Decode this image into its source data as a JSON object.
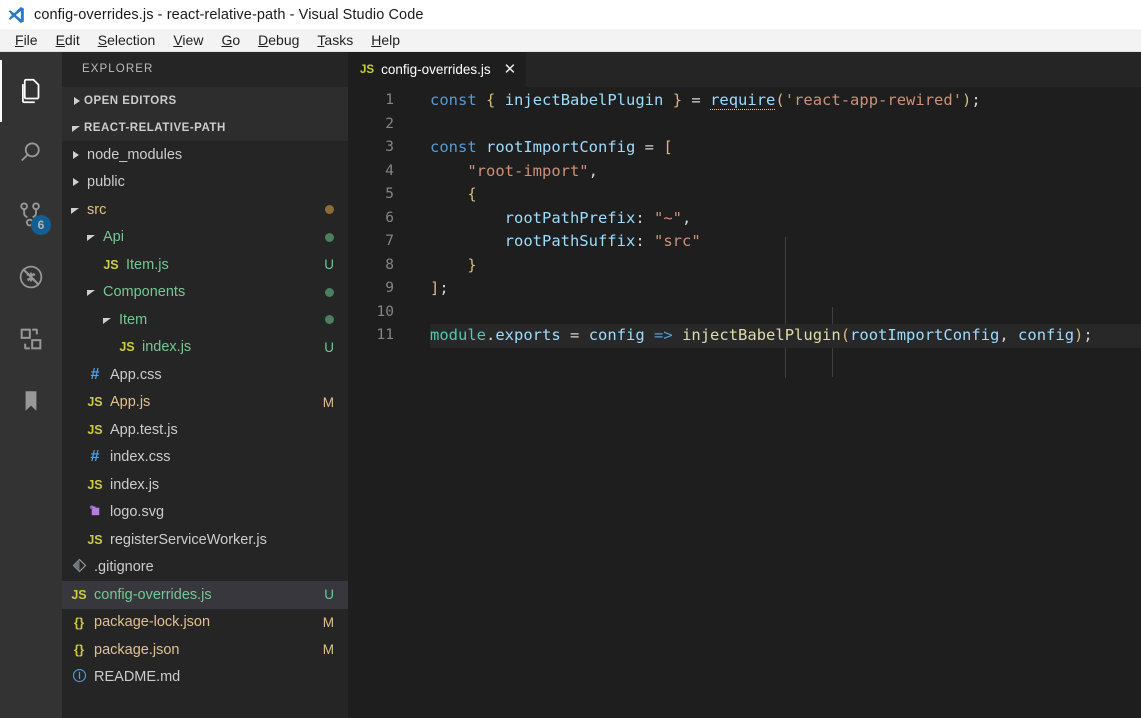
{
  "window": {
    "title": "config-overrides.js - react-relative-path - Visual Studio Code",
    "logo_icon": "vscode-logo-icon"
  },
  "menubar": {
    "items": [
      {
        "label": "File",
        "accel": "F"
      },
      {
        "label": "Edit",
        "accel": "E"
      },
      {
        "label": "Selection",
        "accel": "S"
      },
      {
        "label": "View",
        "accel": "V"
      },
      {
        "label": "Go",
        "accel": "G"
      },
      {
        "label": "Debug",
        "accel": "D"
      },
      {
        "label": "Tasks",
        "accel": "T"
      },
      {
        "label": "Help",
        "accel": "H"
      }
    ]
  },
  "activitybar": {
    "items": [
      {
        "name": "explorer",
        "icon": "files-icon",
        "active": true,
        "badge": ""
      },
      {
        "name": "search",
        "icon": "search-icon",
        "active": false,
        "badge": ""
      },
      {
        "name": "source-control",
        "icon": "source-control-icon",
        "active": false,
        "badge": "6"
      },
      {
        "name": "debug",
        "icon": "debug-icon",
        "active": false,
        "badge": ""
      },
      {
        "name": "extensions",
        "icon": "extensions-icon",
        "active": false,
        "badge": ""
      },
      {
        "name": "bookmarks",
        "icon": "bookmark-icon",
        "active": false,
        "badge": ""
      }
    ],
    "badge_color": "#007acc"
  },
  "sidebar": {
    "title": "EXPLORER",
    "sections": [
      {
        "label": "OPEN EDITORS",
        "expanded": false
      },
      {
        "label": "REACT-RELATIVE-PATH",
        "expanded": true
      }
    ],
    "tree": [
      {
        "label": "node_modules",
        "type": "folder",
        "expanded": false,
        "indent": 1,
        "deco": "",
        "deco_kind": "",
        "color": "default"
      },
      {
        "label": "public",
        "type": "folder",
        "expanded": false,
        "indent": 1,
        "deco": "",
        "deco_kind": "",
        "color": "default"
      },
      {
        "label": "src",
        "type": "folder",
        "expanded": true,
        "indent": 1,
        "deco": "dot",
        "deco_kind": "folder-mod",
        "color": "mod"
      },
      {
        "label": "Api",
        "type": "folder",
        "expanded": true,
        "indent": 2,
        "deco": "dot",
        "deco_kind": "green",
        "color": "green"
      },
      {
        "label": "Item.js",
        "type": "js",
        "expanded": null,
        "indent": 3,
        "deco": "U",
        "deco_kind": "green",
        "color": "green"
      },
      {
        "label": "Components",
        "type": "folder",
        "expanded": true,
        "indent": 2,
        "deco": "dot",
        "deco_kind": "green",
        "color": "green"
      },
      {
        "label": "Item",
        "type": "folder",
        "expanded": true,
        "indent": 3,
        "deco": "dot",
        "deco_kind": "green",
        "color": "green"
      },
      {
        "label": "index.js",
        "type": "js",
        "expanded": null,
        "indent": 4,
        "deco": "U",
        "deco_kind": "green",
        "color": "green"
      },
      {
        "label": "App.css",
        "type": "css",
        "expanded": null,
        "indent": 2,
        "deco": "",
        "deco_kind": "",
        "color": "default"
      },
      {
        "label": "App.js",
        "type": "js",
        "expanded": null,
        "indent": 2,
        "deco": "M",
        "deco_kind": "mod",
        "color": "mod"
      },
      {
        "label": "App.test.js",
        "type": "js",
        "expanded": null,
        "indent": 2,
        "deco": "",
        "deco_kind": "",
        "color": "default"
      },
      {
        "label": "index.css",
        "type": "css",
        "expanded": null,
        "indent": 2,
        "deco": "",
        "deco_kind": "",
        "color": "default"
      },
      {
        "label": "index.js",
        "type": "js",
        "expanded": null,
        "indent": 2,
        "deco": "",
        "deco_kind": "",
        "color": "default"
      },
      {
        "label": "logo.svg",
        "type": "svg",
        "expanded": null,
        "indent": 2,
        "deco": "",
        "deco_kind": "",
        "color": "default"
      },
      {
        "label": "registerServiceWorker.js",
        "type": "js",
        "expanded": null,
        "indent": 2,
        "deco": "",
        "deco_kind": "",
        "color": "default"
      },
      {
        "label": ".gitignore",
        "type": "git",
        "expanded": null,
        "indent": 1,
        "deco": "",
        "deco_kind": "",
        "color": "default"
      },
      {
        "label": "config-overrides.js",
        "type": "js",
        "expanded": null,
        "indent": 1,
        "deco": "U",
        "deco_kind": "green",
        "color": "green",
        "selected": true
      },
      {
        "label": "package-lock.json",
        "type": "json",
        "expanded": null,
        "indent": 1,
        "deco": "M",
        "deco_kind": "mod",
        "color": "mod"
      },
      {
        "label": "package.json",
        "type": "json",
        "expanded": null,
        "indent": 1,
        "deco": "M",
        "deco_kind": "mod",
        "color": "mod"
      },
      {
        "label": "README.md",
        "type": "md",
        "expanded": null,
        "indent": 1,
        "deco": "",
        "deco_kind": "",
        "color": "default"
      }
    ]
  },
  "editor": {
    "tabs": [
      {
        "label": "config-overrides.js",
        "icon": "js-file-icon",
        "active": true,
        "close_icon": "close-icon"
      }
    ],
    "active_line": 11,
    "lines": [
      {
        "n": "1",
        "tokens": [
          {
            "t": "const",
            "c": "key"
          },
          {
            "t": " ",
            "c": "plain"
          },
          {
            "t": "{",
            "c": "br"
          },
          {
            "t": " ",
            "c": "plain"
          },
          {
            "t": "injectBabelPlugin",
            "c": "id"
          },
          {
            "t": " ",
            "c": "plain"
          },
          {
            "t": "}",
            "c": "br"
          },
          {
            "t": " ",
            "c": "plain"
          },
          {
            "t": "=",
            "c": "plain"
          },
          {
            "t": " ",
            "c": "plain"
          },
          {
            "t": "require",
            "c": "id-under"
          },
          {
            "t": "(",
            "c": "br"
          },
          {
            "t": "'react-app-rewired'",
            "c": "str"
          },
          {
            "t": ")",
            "c": "br"
          },
          {
            "t": ";",
            "c": "plain"
          }
        ]
      },
      {
        "n": "2",
        "tokens": []
      },
      {
        "n": "3",
        "tokens": [
          {
            "t": "const",
            "c": "key"
          },
          {
            "t": " ",
            "c": "plain"
          },
          {
            "t": "rootImportConfig",
            "c": "id"
          },
          {
            "t": " ",
            "c": "plain"
          },
          {
            "t": "=",
            "c": "plain"
          },
          {
            "t": " ",
            "c": "plain"
          },
          {
            "t": "[",
            "c": "br"
          }
        ]
      },
      {
        "n": "4",
        "tokens": [
          {
            "t": "    ",
            "c": "plain"
          },
          {
            "t": "\"root-import\"",
            "c": "str"
          },
          {
            "t": ",",
            "c": "plain"
          }
        ]
      },
      {
        "n": "5",
        "tokens": [
          {
            "t": "    ",
            "c": "plain"
          },
          {
            "t": "{",
            "c": "br"
          }
        ]
      },
      {
        "n": "6",
        "tokens": [
          {
            "t": "        ",
            "c": "plain"
          },
          {
            "t": "rootPathPrefix",
            "c": "id"
          },
          {
            "t": ":",
            "c": "plain"
          },
          {
            "t": " ",
            "c": "plain"
          },
          {
            "t": "\"~\"",
            "c": "str"
          },
          {
            "t": ",",
            "c": "plain"
          }
        ]
      },
      {
        "n": "7",
        "tokens": [
          {
            "t": "        ",
            "c": "plain"
          },
          {
            "t": "rootPathSuffix",
            "c": "id"
          },
          {
            "t": ":",
            "c": "plain"
          },
          {
            "t": " ",
            "c": "plain"
          },
          {
            "t": "\"src\"",
            "c": "str"
          }
        ]
      },
      {
        "n": "8",
        "tokens": [
          {
            "t": "    ",
            "c": "plain"
          },
          {
            "t": "}",
            "c": "br"
          }
        ]
      },
      {
        "n": "9",
        "tokens": [
          {
            "t": "]",
            "c": "br"
          },
          {
            "t": ";",
            "c": "plain"
          }
        ]
      },
      {
        "n": "10",
        "tokens": []
      },
      {
        "n": "11",
        "tokens": [
          {
            "t": "module",
            "c": "mod"
          },
          {
            "t": ".",
            "c": "plain"
          },
          {
            "t": "exports",
            "c": "id"
          },
          {
            "t": " ",
            "c": "plain"
          },
          {
            "t": "=",
            "c": "plain"
          },
          {
            "t": " ",
            "c": "plain"
          },
          {
            "t": "config",
            "c": "id"
          },
          {
            "t": " ",
            "c": "plain"
          },
          {
            "t": "=>",
            "c": "op"
          },
          {
            "t": " ",
            "c": "plain"
          },
          {
            "t": "injectBabelPlugin",
            "c": "fn"
          },
          {
            "t": "(",
            "c": "br"
          },
          {
            "t": "rootImportConfig",
            "c": "id"
          },
          {
            "t": ",",
            "c": "plain"
          },
          {
            "t": " ",
            "c": "plain"
          },
          {
            "t": "config",
            "c": "id"
          },
          {
            "t": ")",
            "c": "br"
          },
          {
            "t": ";",
            "c": "plain"
          }
        ],
        "current": true
      }
    ]
  },
  "colors": {
    "titlebar_bg": "#ffffff",
    "menubar_bg": "#f3f3f3",
    "activitybar_bg": "#333333",
    "sidebar_bg": "#252526",
    "editor_bg": "#1e1e1e",
    "accent": "#007acc",
    "selected_row_bg": "#37373d",
    "untracked": "#73c991",
    "modified": "#e2c08d"
  }
}
